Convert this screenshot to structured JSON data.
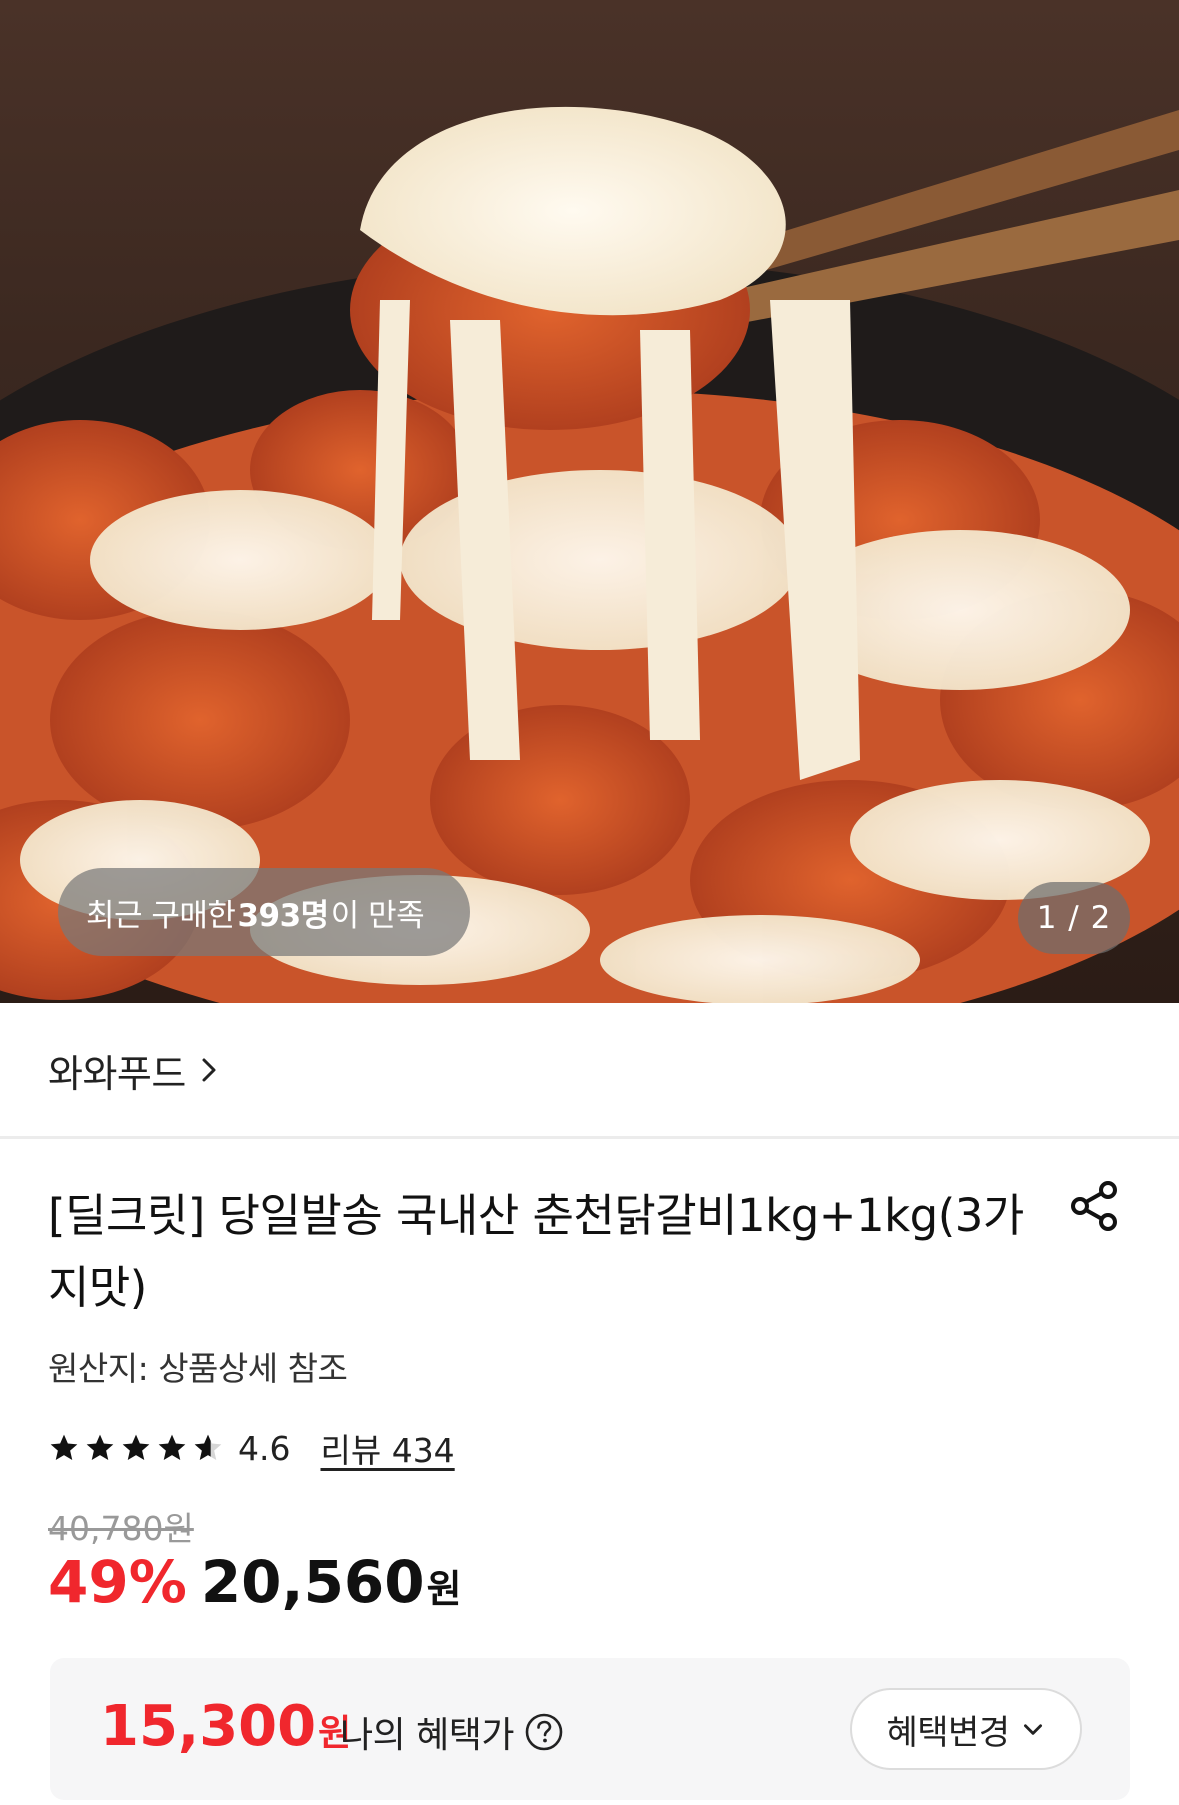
{
  "hero": {
    "image_alt": "",
    "buyers_prefix": "최근 구매한 ",
    "buyers_count": "393명",
    "buyers_suffix": "이 만족",
    "counter": "1 / 2"
  },
  "seller": {
    "name": "와와푸드",
    "icon": "chevron-right-icon"
  },
  "product": {
    "title": "[딜크릿] 당일발송 국내산 춘천닭갈비1kg+1kg(3가지맛)",
    "origin": "원산지: 상품상세 참조",
    "rating": "4.6",
    "rating_value": 4.6,
    "review_link": "리뷰 434",
    "original_price": "40,780원",
    "discount": "49%",
    "price": "20,560",
    "price_unit": "원"
  },
  "benefit": {
    "price": "15,300",
    "price_unit": "원",
    "label": "나의 혜택가",
    "change_button": "혜택변경"
  },
  "colors": {
    "accent": "#f0272d",
    "box_bg": "#f6f6f7"
  }
}
